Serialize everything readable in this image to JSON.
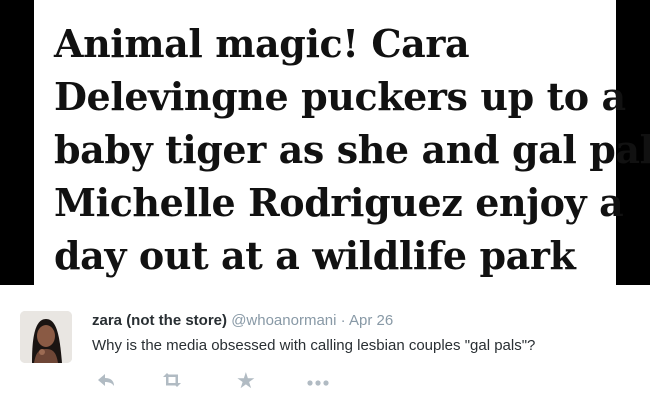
{
  "headline": {
    "lines": [
      "Animal magic! Cara",
      "Delevingne puckers up to a",
      "baby tiger as she and gal pal",
      "Michelle Rodriguez enjoy a",
      "day out at a wildlife park"
    ]
  },
  "tweet": {
    "display_name": "zara (not the store)",
    "handle": "@whoanormani",
    "separator": "·",
    "time": "Apr 26",
    "text": "Why is the media obsessed with calling lesbian couples \"gal pals\"?",
    "icons": {
      "avatar": "profile-photo",
      "reply": "reply-icon",
      "retweet": "retweet-icon",
      "favorite": "star-icon",
      "more": "more-icon"
    }
  }
}
